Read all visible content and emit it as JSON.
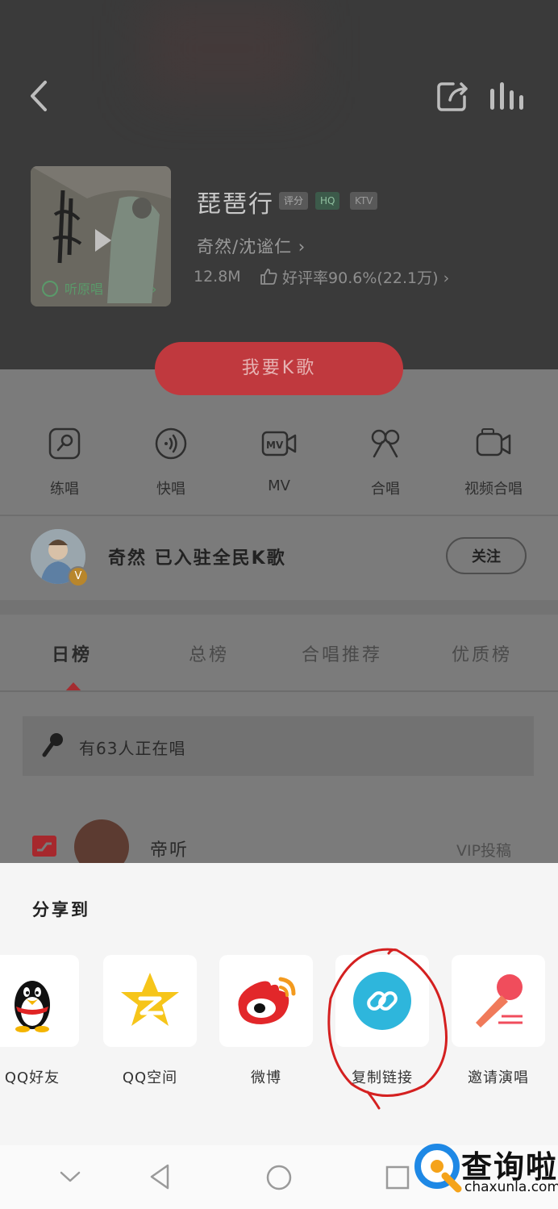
{
  "header": {
    "song_title": "琵琶行",
    "tags": [
      "评分",
      "HQ",
      "KTV"
    ],
    "artist": "奇然/沈谧仁",
    "plays": "12.8M",
    "rating": "好评率90.6%(22.1万)",
    "cover_label": "听原唱",
    "k_button": "我要K歌"
  },
  "features": [
    {
      "label": "练唱",
      "icon": "practice-icon"
    },
    {
      "label": "快唱",
      "icon": "quick-sing-icon"
    },
    {
      "label": "MV",
      "icon": "mv-icon"
    },
    {
      "label": "合唱",
      "icon": "chorus-icon"
    },
    {
      "label": "视频合唱",
      "icon": "video-chorus-icon"
    }
  ],
  "artist_row": {
    "text": "奇然 已入驻全民K歌",
    "follow": "关注",
    "badge": "V"
  },
  "tabs": [
    "日榜",
    "总榜",
    "合唱推荐",
    "优质榜"
  ],
  "singing_now": "有63人正在唱",
  "rank_row": {
    "name": "帝听",
    "tag": "VIP投稿"
  },
  "share": {
    "title": "分享到",
    "items": [
      {
        "label": "QQ好友",
        "icon": "qq-penguin-icon"
      },
      {
        "label": "QQ空间",
        "icon": "qzone-star-icon"
      },
      {
        "label": "微博",
        "icon": "weibo-icon"
      },
      {
        "label": "复制链接",
        "icon": "link-icon"
      },
      {
        "label": "邀请演唱",
        "icon": "microphone-icon"
      }
    ]
  },
  "watermark": {
    "text": "查询啦",
    "url": "chaxunla.com"
  },
  "colors": {
    "accent_red": "#c0393e",
    "link_blue": "#2eb6dc",
    "qzone_yellow": "#f6c51a",
    "weibo_red": "#e2272a"
  }
}
